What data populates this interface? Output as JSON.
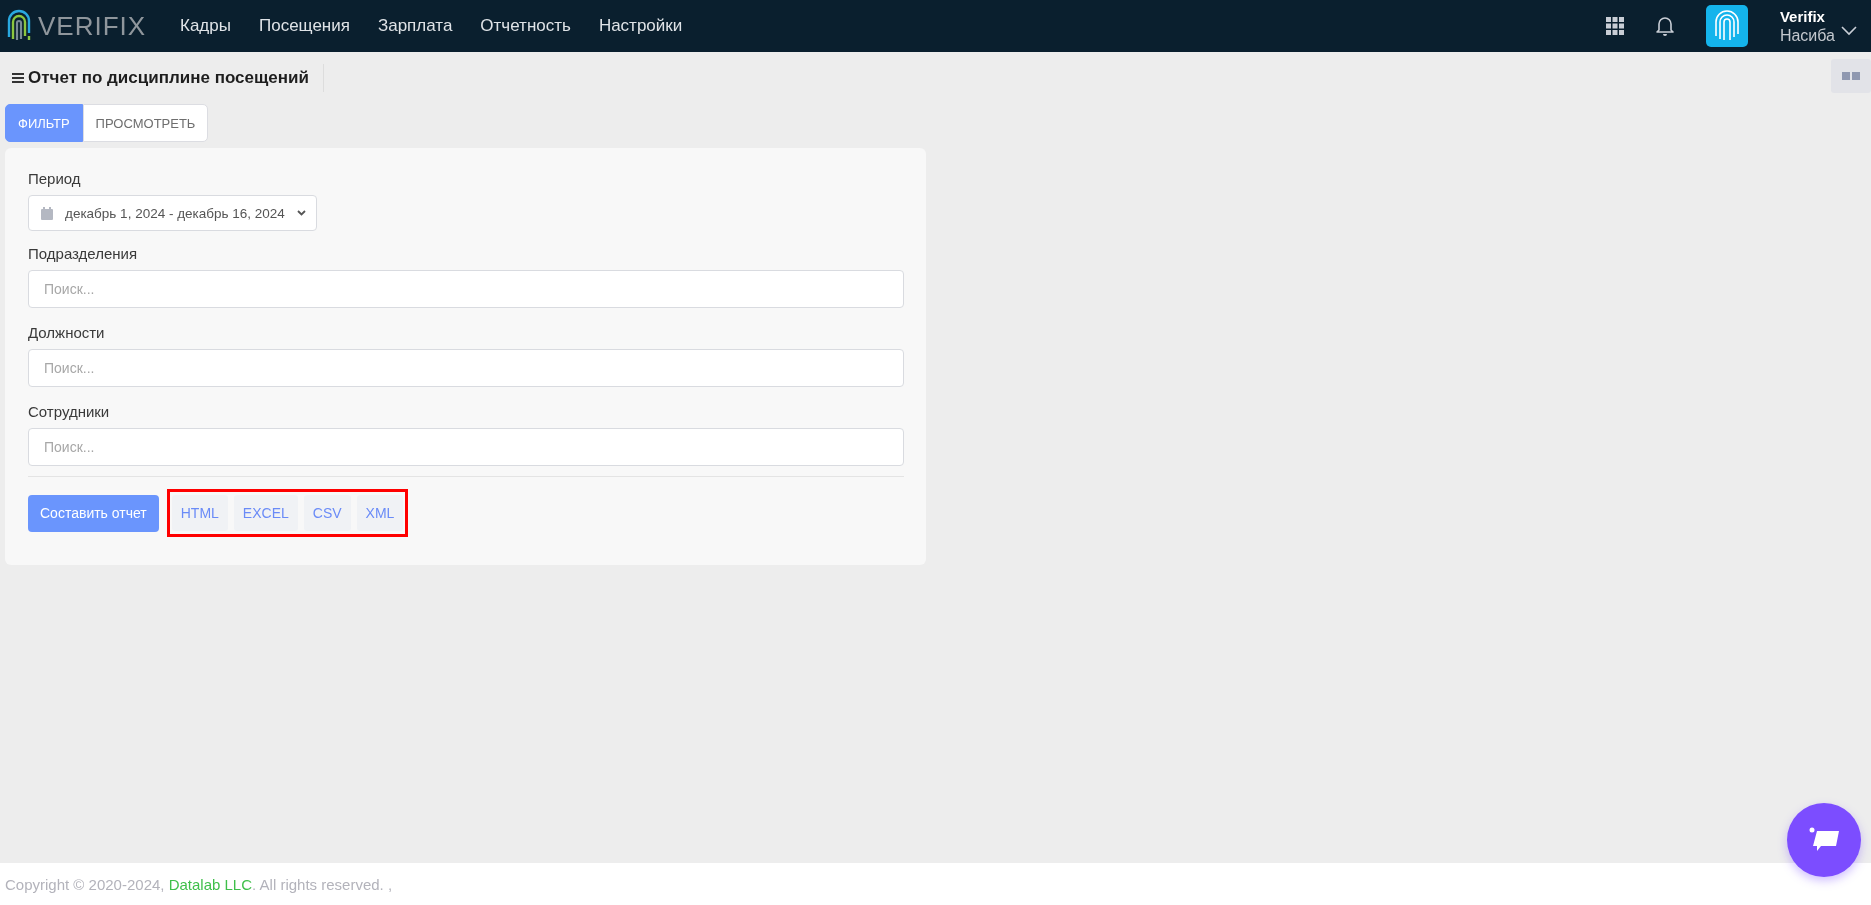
{
  "header": {
    "logo_text": "VERIFIX",
    "nav": [
      {
        "label": "Кадры"
      },
      {
        "label": "Посещения"
      },
      {
        "label": "Зарплата"
      },
      {
        "label": "Отчетность"
      },
      {
        "label": "Настройки"
      }
    ],
    "user": {
      "company": "Verifix",
      "name": "Насиба"
    }
  },
  "page": {
    "title": "Отчет по дисциплине посещений"
  },
  "tabs": [
    {
      "label": "ФИЛЬТР",
      "selected": true
    },
    {
      "label": "ПРОСМОТРЕТЬ",
      "selected": false
    }
  ],
  "filter": {
    "period": {
      "label": "Период",
      "value": "декабрь 1, 2024 - декабрь 16, 2024"
    },
    "fields": [
      {
        "label": "Подразделения",
        "placeholder": "Поиск..."
      },
      {
        "label": "Должности",
        "placeholder": "Поиск..."
      },
      {
        "label": "Сотрудники",
        "placeholder": "Поиск..."
      }
    ],
    "run_button": "Составить отчет",
    "export_buttons": [
      "HTML",
      "EXCEL",
      "CSV",
      "XML"
    ]
  },
  "footer": {
    "prefix": "Copyright © 2020-2024, ",
    "link": "Datalab LLC",
    "suffix": ". All rights reserved. ,"
  }
}
